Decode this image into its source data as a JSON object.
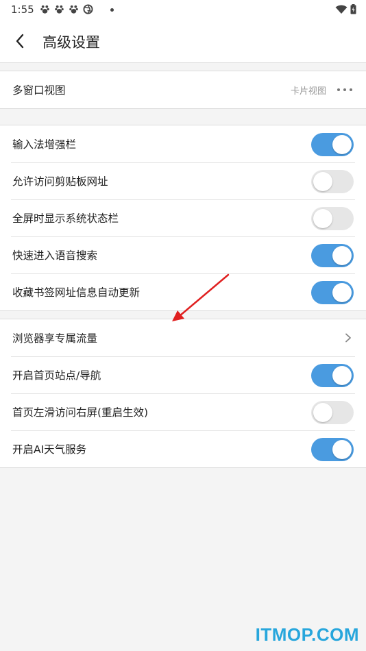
{
  "status_bar": {
    "time": "1:55"
  },
  "header": {
    "title": "高级设置"
  },
  "group1": {
    "multiwindow": {
      "label": "多窗口视图",
      "value": "卡片视图"
    }
  },
  "group2": {
    "items": [
      {
        "label": "输入法增强栏",
        "on": true
      },
      {
        "label": "允许访问剪贴板网址",
        "on": false
      },
      {
        "label": "全屏时显示系统状态栏",
        "on": false
      },
      {
        "label": "快速进入语音搜索",
        "on": true
      },
      {
        "label": "收藏书签网址信息自动更新",
        "on": true
      }
    ]
  },
  "group3": {
    "traffic": {
      "label": "浏览器享专属流量"
    },
    "items": [
      {
        "label": "开启首页站点/导航",
        "on": true
      },
      {
        "label": "首页左滑访问右屏(重启生效)",
        "on": false
      },
      {
        "label": "开启AI天气服务",
        "on": true
      }
    ]
  },
  "watermark": "ITMOP.COM",
  "colors": {
    "accent": "#4a9be0",
    "toggle_off": "#e6e6e6",
    "annotation_arrow": "#e02020"
  }
}
